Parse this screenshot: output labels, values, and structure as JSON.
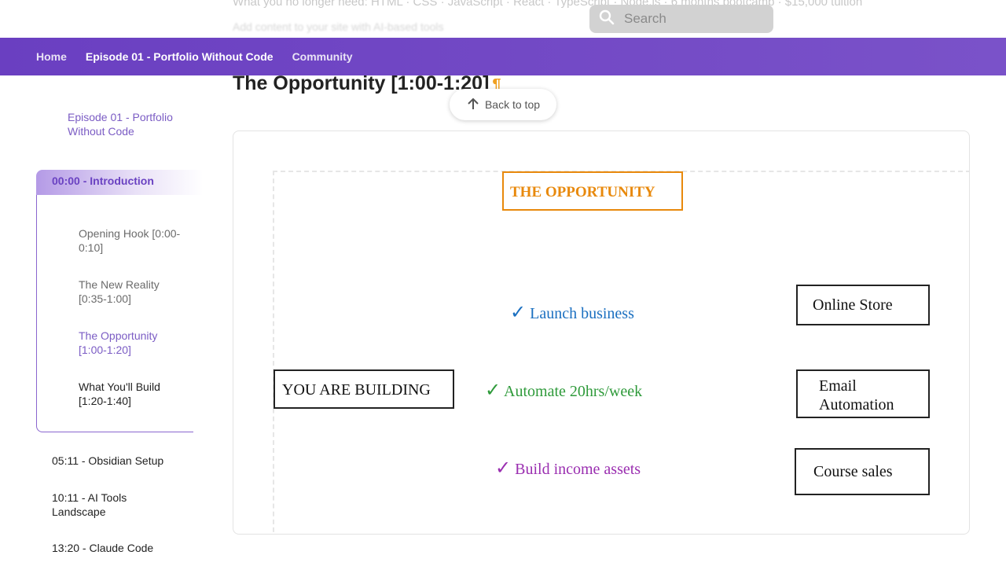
{
  "ghost": {
    "top_text": "What you no longer need: HTML · CSS · JavaScript · React · TypeScript · Node.js · 6 months bootcamp · $15,000 tuition",
    "sub_text": "Add content to your site with AI-based tools"
  },
  "search": {
    "placeholder": "Search",
    "icon": "search-icon"
  },
  "nav": {
    "items": [
      {
        "label": "Home"
      },
      {
        "label": "Episode 01 - Portfolio Without Code"
      },
      {
        "label": "Community"
      }
    ]
  },
  "sidebar": {
    "section_title": "Episode 01 - Portfolio Without Code",
    "active_item": "00:00 - Introduction",
    "sub_items": [
      {
        "label": "Opening Hook [0:00-0:10]"
      },
      {
        "label": "The New Reality [0:35-1:00]"
      },
      {
        "label": "The Opportunity [1:00-1:20]"
      },
      {
        "label": "What You'll Build [1:20-1:40]"
      }
    ],
    "items": [
      {
        "label": "05:11 - Obsidian Setup"
      },
      {
        "label": "10:11 - AI Tools Landscape"
      },
      {
        "label": "13:20 - Claude Code"
      }
    ]
  },
  "main": {
    "heading": "The Opportunity [1:00-1:20]",
    "anchor": "¶",
    "back_to_top": "Back to top",
    "diagram": {
      "title": "THE OPPORTUNITY",
      "center_label": "YOU ARE BUILDING",
      "checks": [
        {
          "mark": "✓",
          "text": "Launch business",
          "color": "#1a6fc0"
        },
        {
          "mark": "✓",
          "text": "Automate 20hrs/week",
          "color": "#2e9a3a"
        },
        {
          "mark": "✓",
          "text": "Build income assets",
          "color": "#9a2eb0"
        }
      ],
      "outcomes": [
        {
          "label": "Online Store"
        },
        {
          "label": "Email Automation"
        },
        {
          "label": "Course sales"
        }
      ]
    }
  },
  "colors": {
    "accent": "#6a3fc1",
    "title_orange": "#e8890c"
  }
}
